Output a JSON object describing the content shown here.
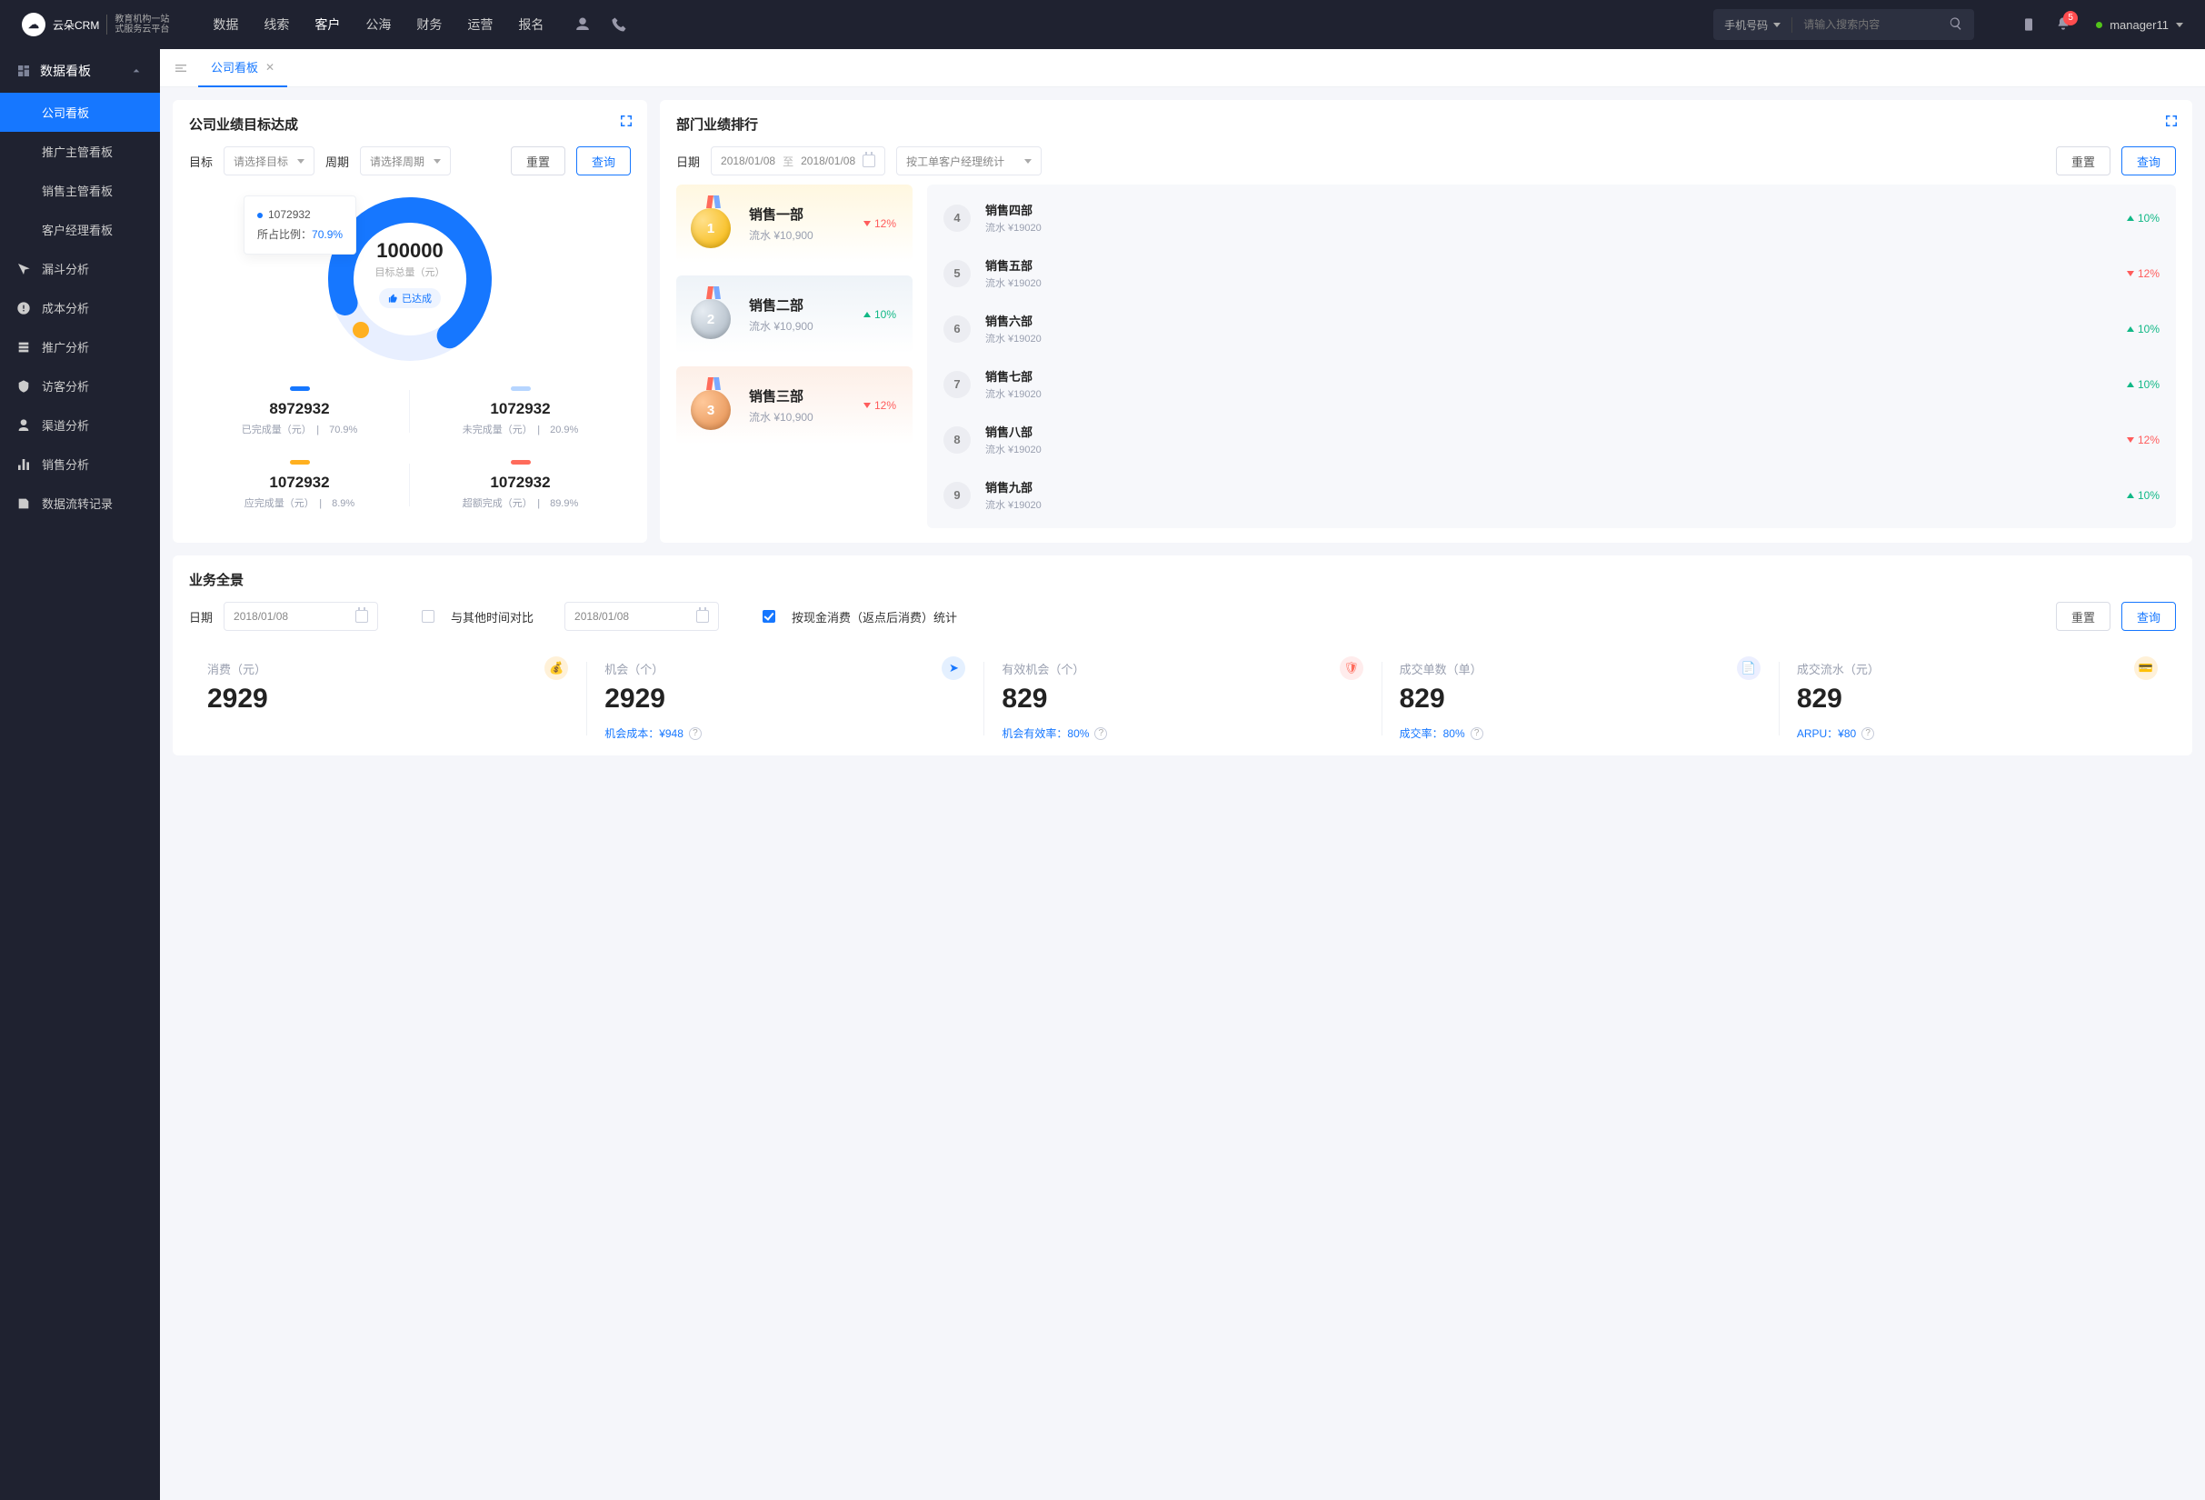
{
  "brand": {
    "name": "云朵CRM",
    "tagline1": "教育机构一站",
    "tagline2": "式服务云平台"
  },
  "topnav": {
    "items": [
      "数据",
      "线索",
      "客户",
      "公海",
      "财务",
      "运营",
      "报名"
    ],
    "active_index": 2,
    "search_type": "手机号码",
    "search_placeholder": "请输入搜索内容",
    "notif_count": "5",
    "username": "manager11"
  },
  "sidebar": {
    "header": "数据看板",
    "sub_items": [
      "公司看板",
      "推广主管看板",
      "销售主管看板",
      "客户经理看板"
    ],
    "active_sub": 0,
    "items": [
      "漏斗分析",
      "成本分析",
      "推广分析",
      "访客分析",
      "渠道分析",
      "销售分析",
      "数据流转记录"
    ]
  },
  "tabs": {
    "name": "公司看板"
  },
  "goal_card": {
    "title": "公司业绩目标达成",
    "labels": {
      "target": "目标",
      "period": "周期"
    },
    "target_placeholder": "请选择目标",
    "period_placeholder": "请选择周期",
    "reset": "重置",
    "query": "查询",
    "tooltip_value": "1072932",
    "tooltip_label": "所占比例：",
    "tooltip_pct": "70.9%",
    "center_value": "100000",
    "center_label": "目标总量（元）",
    "badge": "已达成",
    "stats": [
      {
        "color": "c-blue",
        "value": "8972932",
        "label": "已完成量（元）",
        "extra": "70.9%"
      },
      {
        "color": "c-lblue",
        "value": "1072932",
        "label": "未完成量（元）",
        "extra": "20.9%"
      },
      {
        "color": "c-orange",
        "value": "1072932",
        "label": "应完成量（元）",
        "extra": "8.9%"
      },
      {
        "color": "c-red",
        "value": "1072932",
        "label": "超额完成（元）",
        "extra": "89.9%"
      }
    ]
  },
  "rank_card": {
    "title": "部门业绩排行",
    "labels": {
      "date": "日期",
      "to": "至"
    },
    "date_from": "2018/01/08",
    "date_to": "2018/01/08",
    "select_text": "按工单客户经理统计",
    "reset": "重置",
    "query": "查询",
    "medals": [
      {
        "rank": "1",
        "name": "销售一部",
        "flow": "流水 ¥10,900",
        "delta": "12%",
        "dir": "down",
        "cls": "gold"
      },
      {
        "rank": "2",
        "name": "销售二部",
        "flow": "流水 ¥10,900",
        "delta": "10%",
        "dir": "up",
        "cls": "silver"
      },
      {
        "rank": "3",
        "name": "销售三部",
        "flow": "流水 ¥10,900",
        "delta": "12%",
        "dir": "down",
        "cls": "bronze"
      }
    ],
    "list": [
      {
        "rank": "4",
        "name": "销售四部",
        "flow": "流水 ¥19020",
        "delta": "10%",
        "dir": "up"
      },
      {
        "rank": "5",
        "name": "销售五部",
        "flow": "流水 ¥19020",
        "delta": "12%",
        "dir": "down"
      },
      {
        "rank": "6",
        "name": "销售六部",
        "flow": "流水 ¥19020",
        "delta": "10%",
        "dir": "up"
      },
      {
        "rank": "7",
        "name": "销售七部",
        "flow": "流水 ¥19020",
        "delta": "10%",
        "dir": "up"
      },
      {
        "rank": "8",
        "name": "销售八部",
        "flow": "流水 ¥19020",
        "delta": "12%",
        "dir": "down"
      },
      {
        "rank": "9",
        "name": "销售九部",
        "flow": "流水 ¥19020",
        "delta": "10%",
        "dir": "up"
      }
    ]
  },
  "overview": {
    "title": "业务全景",
    "labels": {
      "date": "日期",
      "compare": "与其他时间对比",
      "cash": "按现金消费（返点后消费）统计"
    },
    "date1": "2018/01/08",
    "date2": "2018/01/08",
    "reset": "重置",
    "query": "查询",
    "metrics": [
      {
        "label": "消费（元）",
        "value": "2929",
        "foot_label": "",
        "foot_val": "",
        "ic": "i-bag"
      },
      {
        "label": "机会（个）",
        "value": "2929",
        "foot_label": "机会成本：",
        "foot_val": "¥948",
        "ic": "i-send"
      },
      {
        "label": "有效机会（个）",
        "value": "829",
        "foot_label": "机会有效率：",
        "foot_val": "80%",
        "ic": "i-shield"
      },
      {
        "label": "成交单数（单）",
        "value": "829",
        "foot_label": "成交率：",
        "foot_val": "80%",
        "ic": "i-doc"
      },
      {
        "label": "成交流水（元）",
        "value": "829",
        "foot_label": "ARPU：",
        "foot_val": "¥80",
        "ic": "i-card"
      }
    ]
  },
  "chart_data": {
    "type": "pie",
    "title": "目标总量（元） 100000",
    "series": [
      {
        "name": "已完成量",
        "value": 8972932,
        "pct": 70.9,
        "color": "#1677ff"
      },
      {
        "name": "未完成量",
        "value": 1072932,
        "pct": 20.9,
        "color": "#b6d5ff"
      },
      {
        "name": "应完成量",
        "value": 1072932,
        "pct": 8.9,
        "color": "#ffb020"
      },
      {
        "name": "超额完成",
        "value": 1072932,
        "pct": 89.9,
        "color": "#ff6b5b"
      }
    ]
  }
}
